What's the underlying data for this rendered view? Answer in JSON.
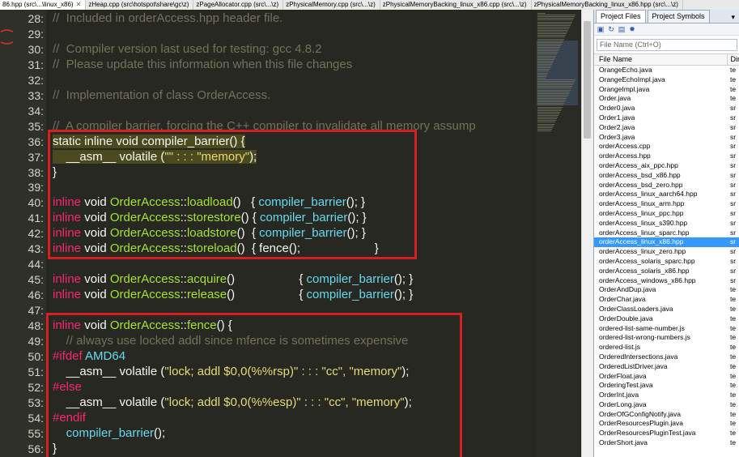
{
  "tabs": [
    {
      "label": "86.hpp (src\\...\\linux_x86)",
      "close": "✕",
      "active": true
    },
    {
      "label": "zHeap.cpp (src\\hotspot\\share\\gc\\z)",
      "active": false
    },
    {
      "label": "zPageAllocator.cpp (src\\...\\z)",
      "active": false
    },
    {
      "label": "zPhysicalMemory.cpp (src\\...\\z)",
      "active": false
    },
    {
      "label": "zPhysicalMemoryBacking_linux_x86.cpp (src\\...\\z)",
      "active": false
    },
    {
      "label": "zPhysicalMemoryBacking_linux_x86.hpp (src\\...\\z)",
      "active": false
    }
  ],
  "editor": {
    "lines": [
      {
        "n": "28:",
        "html": "<span class='cm'>//  Included in orderAccess.hpp header file.</span>"
      },
      {
        "n": "29:",
        "html": ""
      },
      {
        "n": "30:",
        "html": "<span class='cm'>//  Compiler version last used for testing: gcc 4.8.2</span>"
      },
      {
        "n": "31:",
        "html": "<span class='cm'>//  Please update this information when this file changes</span>"
      },
      {
        "n": "32:",
        "html": ""
      },
      {
        "n": "33:",
        "html": "<span class='cm'>//  Implementation of class OrderAccess.</span>"
      },
      {
        "n": "34:",
        "html": ""
      },
      {
        "n": "35:",
        "html": "<span class='cm'>//  A compiler barrier, forcing the C++ compiler to invalidate all memory assump</span>"
      },
      {
        "n": "36:",
        "html": "<span class='hl'>static inline void compiler_barrier() {</span>"
      },
      {
        "n": "37:",
        "html": "<span class='hl'>    __asm__ volatile (<span class='str'>\"\" : : : \"memory\"</span>);</span>"
      },
      {
        "n": "38:",
        "html": "}"
      },
      {
        "n": "39:",
        "html": ""
      },
      {
        "n": "40:",
        "html": "<span class='kw'>inline</span> void <span class='cls'>OrderAccess</span>::<span class='cls'>loadload</span>()   { <span class='fn'>compiler_barrier</span>(); }"
      },
      {
        "n": "41:",
        "html": "<span class='kw'>inline</span> void <span class='cls'>OrderAccess</span>::<span class='cls'>storestore</span>() { <span class='fn'>compiler_barrier</span>(); }"
      },
      {
        "n": "42:",
        "html": "<span class='kw'>inline</span> void <span class='cls'>OrderAccess</span>::<span class='cls'>loadstore</span>()  { <span class='fn'>compiler_barrier</span>(); }"
      },
      {
        "n": "43:",
        "html": "<span class='kw'>inline</span> void <span class='cls'>OrderAccess</span>::<span class='cls'>storeload</span>()  { fence();                      }"
      },
      {
        "n": "44:",
        "html": ""
      },
      {
        "n": "45:",
        "html": "<span class='kw'>inline</span> void <span class='cls'>OrderAccess</span>::<span class='cls'>acquire</span>()                   { <span class='fn'>compiler_barrier</span>(); }"
      },
      {
        "n": "46:",
        "html": "<span class='kw'>inline</span> void <span class='cls'>OrderAccess</span>::<span class='cls'>release</span>()                   { <span class='fn'>compiler_barrier</span>(); }"
      },
      {
        "n": "47:",
        "html": ""
      },
      {
        "n": "48:",
        "html": "<span class='kw'>inline</span> void <span class='cls'>OrderAccess</span>::<span class='cls'>fence</span>() {"
      },
      {
        "n": "49:",
        "html": "    <span class='cm'>// always use locked addl since mfence is sometimes expensive</span>"
      },
      {
        "n": "50:",
        "html": "<span class='pp'>#ifdef</span> <span class='fn'>AMD64</span>"
      },
      {
        "n": "51:",
        "html": "    __asm__ volatile (<span class='str'>\"lock; addl $0,0(%%rsp)\" : : : \"cc\", \"memory\"</span>);"
      },
      {
        "n": "52:",
        "html": "<span class='pp'>#else</span>"
      },
      {
        "n": "53:",
        "html": "    __asm__ volatile (<span class='str'>\"lock; addl $0,0(%%esp)\" : : : \"cc\", \"memory\"</span>);"
      },
      {
        "n": "54:",
        "html": "<span class='pp'>#endif</span>"
      },
      {
        "n": "55:",
        "html": "    <span class='fn'>compiler_barrier</span>();"
      },
      {
        "n": "56:",
        "html": "}"
      }
    ]
  },
  "panel": {
    "tab_files": "Project Files",
    "tab_symbols": "Project Symbols",
    "chevron": "▾",
    "filter_placeholder": "File Name (Ctrl+O)",
    "col_file": "File Name",
    "col_dir": "Dir",
    "files": [
      {
        "name": "OrangeEcho.java",
        "dir": "te"
      },
      {
        "name": "OrangeEchoImpl.java",
        "dir": "te"
      },
      {
        "name": "OrangeImpl.java",
        "dir": "te"
      },
      {
        "name": "Order.java",
        "dir": "te"
      },
      {
        "name": "Order0.java",
        "dir": "sr"
      },
      {
        "name": "Order1.java",
        "dir": "sr"
      },
      {
        "name": "Order2.java",
        "dir": "sr"
      },
      {
        "name": "Order3.java",
        "dir": "sr"
      },
      {
        "name": "orderAccess.cpp",
        "dir": "sr"
      },
      {
        "name": "orderAccess.hpp",
        "dir": "sr"
      },
      {
        "name": "orderAccess_aix_ppc.hpp",
        "dir": "sr"
      },
      {
        "name": "orderAccess_bsd_x86.hpp",
        "dir": "sr"
      },
      {
        "name": "orderAccess_bsd_zero.hpp",
        "dir": "sr"
      },
      {
        "name": "orderAccess_linux_aarch64.hpp",
        "dir": "sr"
      },
      {
        "name": "orderAccess_linux_arm.hpp",
        "dir": "sr"
      },
      {
        "name": "orderAccess_linux_ppc.hpp",
        "dir": "sr"
      },
      {
        "name": "orderAccess_linux_s390.hpp",
        "dir": "sr"
      },
      {
        "name": "orderAccess_linux_sparc.hpp",
        "dir": "sr"
      },
      {
        "name": "orderAccess_linux_x86.hpp",
        "dir": "sr",
        "selected": true
      },
      {
        "name": "orderAccess_linux_zero.hpp",
        "dir": "sr"
      },
      {
        "name": "orderAccess_solaris_sparc.hpp",
        "dir": "sr"
      },
      {
        "name": "orderAccess_solaris_x86.hpp",
        "dir": "sr"
      },
      {
        "name": "orderAccess_windows_x86.hpp",
        "dir": "sr"
      },
      {
        "name": "OrderAndDup.java",
        "dir": "te"
      },
      {
        "name": "OrderChar.java",
        "dir": "te"
      },
      {
        "name": "OrderClassLoaders.java",
        "dir": "te"
      },
      {
        "name": "OrderDouble.java",
        "dir": "te"
      },
      {
        "name": "ordered-list-same-number.js",
        "dir": "te"
      },
      {
        "name": "ordered-list-wrong-numbers.js",
        "dir": "te"
      },
      {
        "name": "ordered-list.js",
        "dir": "te"
      },
      {
        "name": "OrderedIntersections.java",
        "dir": "te"
      },
      {
        "name": "OrderedListDriver.java",
        "dir": "te"
      },
      {
        "name": "OrderFloat.java",
        "dir": "te"
      },
      {
        "name": "OrderingTest.java",
        "dir": "te"
      },
      {
        "name": "OrderInt.java",
        "dir": "te"
      },
      {
        "name": "OrderLong.java",
        "dir": "te"
      },
      {
        "name": "OrderOfGConfigNotify.java",
        "dir": "te"
      },
      {
        "name": "OrderResourcesPlugin.java",
        "dir": "te"
      },
      {
        "name": "OrderResourcesPluginTest.java",
        "dir": "te"
      },
      {
        "name": "OrderShort.java",
        "dir": "te"
      }
    ]
  },
  "colors": {
    "editor_bg": "#272822",
    "annotation_red": "#d42020",
    "selection_blue": "#3399ff"
  }
}
